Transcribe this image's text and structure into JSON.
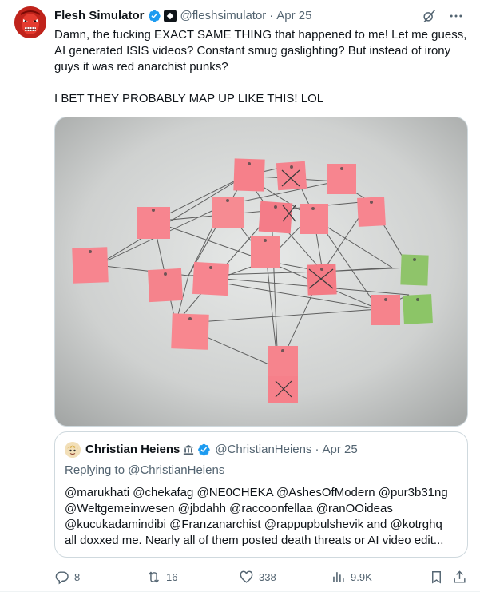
{
  "author": {
    "display_name": "Flesh Simulator",
    "handle": "@fleshsimulator",
    "separator": "·",
    "date": "Apr 25"
  },
  "tweet": {
    "paragraphs": [
      "Damn, the fucking EXACT SAME THING that happened to me! Let me guess, AI generated ISIS videos? Constant smug gaslighting? But instead of irony guys it was red anarchist punks?",
      "I BET THEY PROBABLY MAP UP LIKE THIS! LOL"
    ]
  },
  "quote": {
    "display_name": "Christian Heiens",
    "handle": "@ChristianHeiens",
    "separator": "·",
    "date": "Apr 25",
    "replying_to": "Replying to @ChristianHeiens",
    "lines": [
      "@marukhati @chekafag @NE0CHEKA @AshesOfModern @pur3b31ng",
      "@Weltgemeinwesen @jbdahh @raccoonfellaa @ranOOideas",
      "@kucukadamindibi @Franzanarchist @rappupbulshevik and @kotrghq",
      "all doxxed me. Nearly all of them posted death threats or AI video edit..."
    ]
  },
  "actions": {
    "replies": "8",
    "reposts": "16",
    "likes": "338",
    "views": "9.9K"
  },
  "icons": {
    "verified": "verified-badge-icon",
    "affiliate": "affiliate-badge-icon",
    "grok": "grok-icon",
    "more": "more-icon",
    "reply": "reply-icon",
    "repost": "repost-icon",
    "like": "heart-icon",
    "views": "views-icon",
    "bookmark": "bookmark-icon",
    "share": "share-icon"
  },
  "colors": {
    "text": "#0f1419",
    "secondary": "#536471",
    "verified_blue": "#1d9bf0",
    "border": "#cfd9de",
    "note_pink": "#f7858f",
    "note_green": "#8fc46a"
  }
}
